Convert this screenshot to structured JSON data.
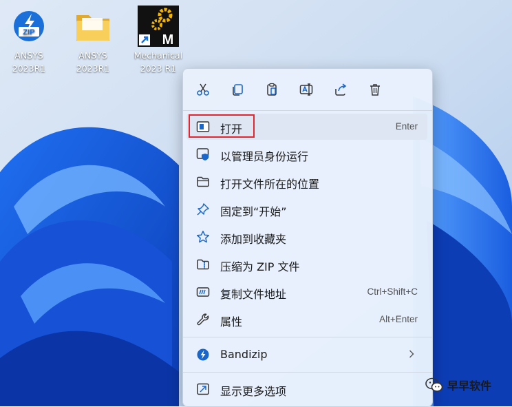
{
  "desktop": {
    "icons": [
      {
        "icon": "zip-archive-icon",
        "line1": "ANSYS",
        "line2": "2023R1"
      },
      {
        "icon": "folder-icon",
        "line1": "ANSYS",
        "line2": "2023R1"
      },
      {
        "icon": "mechanical-shortcut-icon",
        "line1": "Mechanical",
        "line2": "2023 R1"
      }
    ]
  },
  "context_menu": {
    "toolbar": [
      {
        "action": "cut",
        "icon": "scissors-icon"
      },
      {
        "action": "copy",
        "icon": "copy-icon"
      },
      {
        "action": "paste",
        "icon": "paste-icon"
      },
      {
        "action": "rename",
        "icon": "rename-icon"
      },
      {
        "action": "share",
        "icon": "share-icon"
      },
      {
        "action": "delete",
        "icon": "trash-icon"
      }
    ],
    "items": [
      {
        "label": "打开",
        "shortcut": "Enter",
        "icon": "open-window-icon",
        "highlighted": true
      },
      {
        "label": "以管理员身份运行",
        "shortcut": "",
        "icon": "shield-window-icon"
      },
      {
        "label": "打开文件所在的位置",
        "shortcut": "",
        "icon": "folder-outline-icon"
      },
      {
        "label": "固定到“开始”",
        "shortcut": "",
        "icon": "pin-icon"
      },
      {
        "label": "添加到收藏夹",
        "shortcut": "",
        "icon": "star-icon"
      },
      {
        "label": "压缩为 ZIP 文件",
        "shortcut": "",
        "icon": "zip-folder-icon"
      },
      {
        "label": "复制文件地址",
        "shortcut": "Ctrl+Shift+C",
        "icon": "copy-path-icon"
      },
      {
        "label": "属性",
        "shortcut": "Alt+Enter",
        "icon": "wrench-icon"
      }
    ],
    "bandizip": {
      "label": "Bandizip",
      "icon": "bandizip-icon"
    },
    "more": {
      "label": "显示更多选项",
      "icon": "show-more-icon"
    }
  },
  "watermark": {
    "text": "早早软件",
    "icon": "wechat-icon"
  },
  "colors": {
    "accent": "#1a67c9",
    "highlight_border": "#e0262f",
    "menu_bg": "#e8f0fc"
  }
}
